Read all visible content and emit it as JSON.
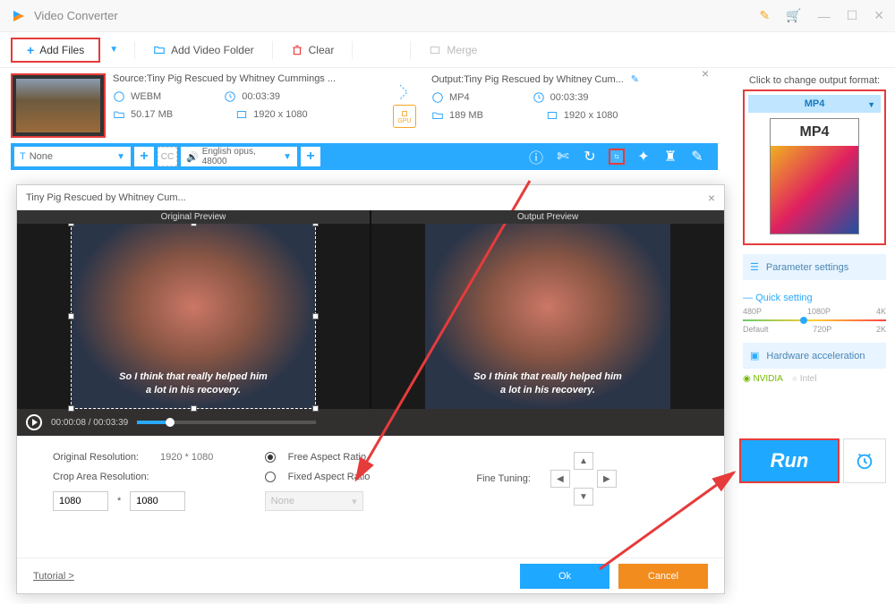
{
  "titlebar": {
    "title": "Video Converter"
  },
  "toolbar": {
    "add_files": "Add Files",
    "add_folder": "Add Video Folder",
    "clear": "Clear",
    "merge": "Merge"
  },
  "file": {
    "source_prefix": "Source: ",
    "source_name": "Tiny Pig Rescued by Whitney Cummings ...",
    "output_prefix": "Output: ",
    "output_name": "Tiny Pig Rescued by Whitney Cum...",
    "src_format": "WEBM",
    "src_duration": "00:03:39",
    "src_size": "50.17 MB",
    "src_resolution": "1920 x 1080",
    "out_format": "MP4",
    "out_duration": "00:03:39",
    "out_size": "189 MB",
    "out_resolution": "1920 x 1080",
    "gpu_label": "GPU"
  },
  "action_bar": {
    "subtitle_value": "None",
    "audio_value": "English opus, 48000"
  },
  "right_panel": {
    "top_label": "Click to change output format:",
    "format_name": "MP4",
    "big_label": "MP4",
    "param_settings": "Parameter settings",
    "quick_setting": "Quick setting",
    "marks": {
      "p480": "480P",
      "p1080": "1080P",
      "p4k": "4K",
      "default": "Default",
      "p720": "720P",
      "p2k": "2K"
    },
    "hw_accel": "Hardware acceleration",
    "nvidia": "NVIDIA",
    "intel": "Intel"
  },
  "run": {
    "label": "Run"
  },
  "crop": {
    "title": "Tiny Pig Rescued by Whitney Cum...",
    "original_preview": "Original Preview",
    "output_preview": "Output Preview",
    "subtitle_line1": "So I think that really helped him",
    "subtitle_line2": "a lot in his recovery.",
    "time_current": "00:00:08",
    "time_total": "00:03:39",
    "orig_res_label": "Original Resolution:",
    "orig_res_value": "1920 * 1080",
    "crop_res_label": "Crop Area Resolution:",
    "crop_w": "1080",
    "crop_h": "1080",
    "free_ar": "Free Aspect Ratio",
    "fixed_ar": "Fixed Aspect Ratio",
    "combo_none": "None",
    "fine_tuning": "Fine Tuning:",
    "tutorial": "Tutorial >",
    "ok": "Ok",
    "cancel": "Cancel"
  }
}
